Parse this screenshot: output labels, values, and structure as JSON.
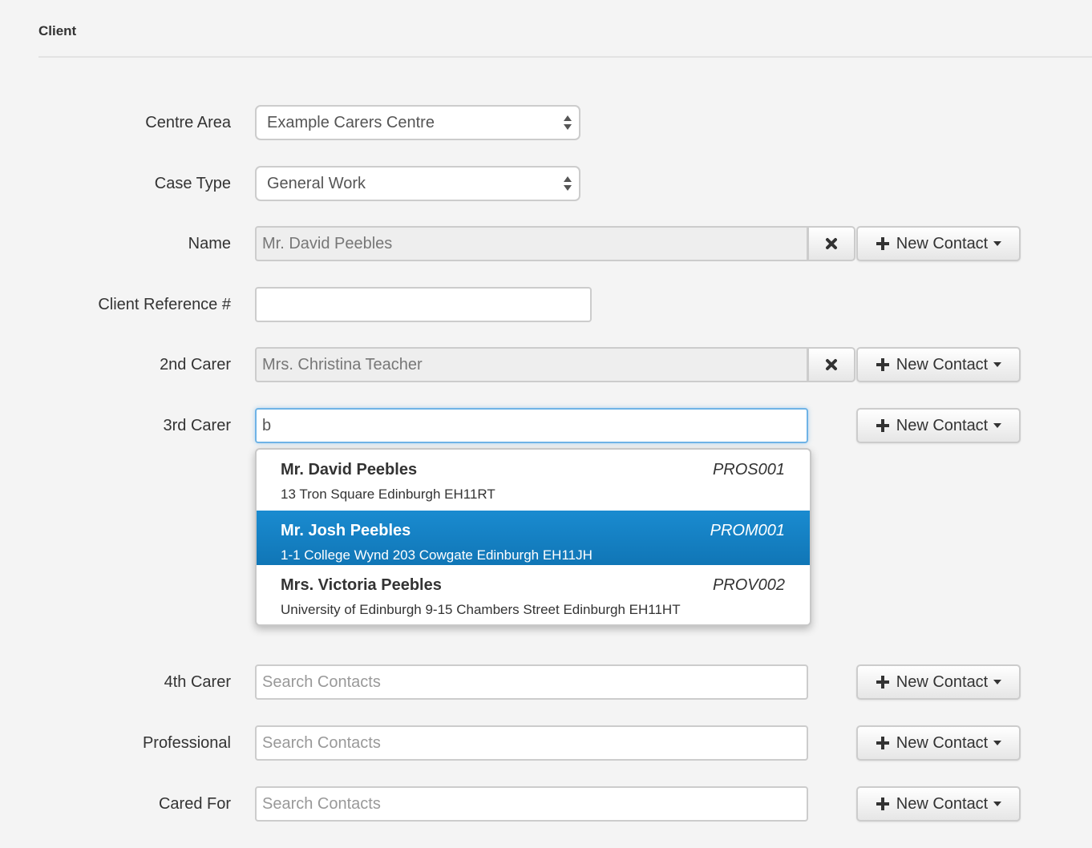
{
  "section": {
    "title": "Client"
  },
  "fields": {
    "centre_area": {
      "label": "Centre Area",
      "value": "Example Carers Centre"
    },
    "case_type": {
      "label": "Case Type",
      "value": "General Work"
    },
    "name": {
      "label": "Name",
      "value": "Mr. David Peebles"
    },
    "client_reference": {
      "label": "Client Reference #",
      "value": ""
    },
    "second_carer": {
      "label": "2nd Carer",
      "value": "Mrs. Christina Teacher"
    },
    "third_carer": {
      "label": "3rd Carer",
      "value": "b"
    },
    "fourth_carer": {
      "label": "4th Carer",
      "placeholder": "Search Contacts"
    },
    "professional": {
      "label": "Professional",
      "placeholder": "Search Contacts"
    },
    "cared_for": {
      "label": "Cared For",
      "placeholder": "Search Contacts"
    }
  },
  "buttons": {
    "new_contact": "New Contact",
    "clear_icon": "times-icon",
    "plus_icon": "plus-icon"
  },
  "autocomplete": {
    "highlight_color": "#1580c3",
    "items": [
      {
        "name": "Mr. David Peebles",
        "code": "PROS001",
        "address": "13 Tron Square Edinburgh EH11RT",
        "active": false
      },
      {
        "name": "Mr. Josh Peebles",
        "code": "PROM001",
        "address": "1-1 College Wynd 203 Cowgate Edinburgh EH11JH",
        "active": true
      },
      {
        "name": "Mrs. Victoria Peebles",
        "code": "PROV002",
        "address": "University of Edinburgh 9-15 Chambers Street Edinburgh EH11HT",
        "active": false
      }
    ]
  }
}
